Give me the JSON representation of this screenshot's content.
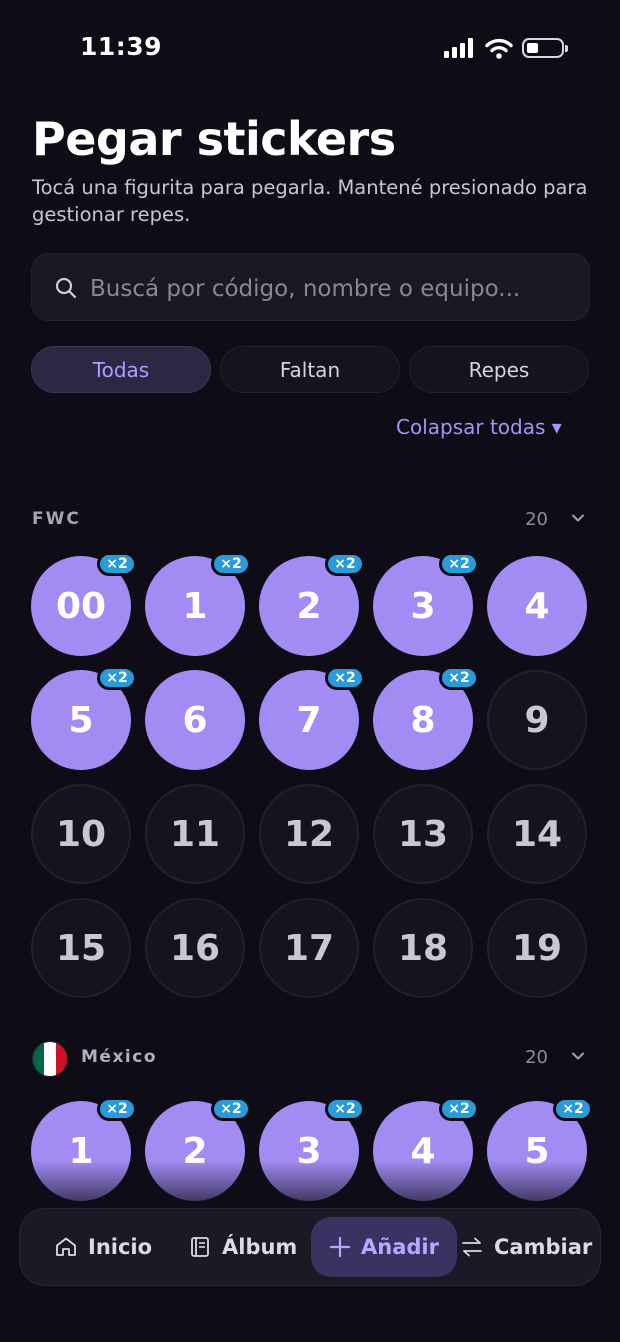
{
  "status_bar": {
    "time": "11:39"
  },
  "header": {
    "title": "Pegar stickers",
    "subtitle": "Tocá una figurita para pegarla. Mantené presionado para gestionar repes."
  },
  "search": {
    "placeholder": "Buscá por código, nombre o equipo..."
  },
  "filters": [
    {
      "label": "Todas",
      "active": true
    },
    {
      "label": "Faltan",
      "active": false
    },
    {
      "label": "Repes",
      "active": false
    }
  ],
  "collapse_label": "Colapsar todas ▾",
  "sections": [
    {
      "code": "FWC",
      "count": "20",
      "stickers": [
        {
          "label": "00",
          "owned": true,
          "dup": "×2"
        },
        {
          "label": "1",
          "owned": true,
          "dup": "×2"
        },
        {
          "label": "2",
          "owned": true,
          "dup": "×2"
        },
        {
          "label": "3",
          "owned": true,
          "dup": "×2"
        },
        {
          "label": "4",
          "owned": true,
          "dup": ""
        },
        {
          "label": "5",
          "owned": true,
          "dup": "×2"
        },
        {
          "label": "6",
          "owned": true,
          "dup": ""
        },
        {
          "label": "7",
          "owned": true,
          "dup": "×2"
        },
        {
          "label": "8",
          "owned": true,
          "dup": "×2"
        },
        {
          "label": "9",
          "owned": false,
          "dup": ""
        },
        {
          "label": "10",
          "owned": false,
          "dup": ""
        },
        {
          "label": "11",
          "owned": false,
          "dup": ""
        },
        {
          "label": "12",
          "owned": false,
          "dup": ""
        },
        {
          "label": "13",
          "owned": false,
          "dup": ""
        },
        {
          "label": "14",
          "owned": false,
          "dup": ""
        },
        {
          "label": "15",
          "owned": false,
          "dup": ""
        },
        {
          "label": "16",
          "owned": false,
          "dup": ""
        },
        {
          "label": "17",
          "owned": false,
          "dup": ""
        },
        {
          "label": "18",
          "owned": false,
          "dup": ""
        },
        {
          "label": "19",
          "owned": false,
          "dup": ""
        }
      ]
    },
    {
      "name": "México",
      "flag_colors": [
        "#006847",
        "#ffffff",
        "#ce1126"
      ],
      "count": "20",
      "stickers": [
        {
          "label": "1",
          "owned": true,
          "dup": "×2"
        },
        {
          "label": "2",
          "owned": true,
          "dup": "×2"
        },
        {
          "label": "3",
          "owned": true,
          "dup": "×2"
        },
        {
          "label": "4",
          "owned": true,
          "dup": "×2"
        },
        {
          "label": "5",
          "owned": true,
          "dup": "×2"
        }
      ]
    }
  ],
  "tabbar": {
    "items": [
      {
        "label": "Inicio",
        "icon": "home-icon",
        "active": false
      },
      {
        "label": "Álbum",
        "icon": "album-icon",
        "active": false
      },
      {
        "label": "Añadir",
        "icon": "plus-icon",
        "active": true
      },
      {
        "label": "Cambiar",
        "icon": "swap-icon",
        "active": false
      }
    ]
  },
  "colors": {
    "accent": "#a28cf3",
    "duplicate_badge": "#2a9ad8",
    "background": "#0e0c16"
  }
}
